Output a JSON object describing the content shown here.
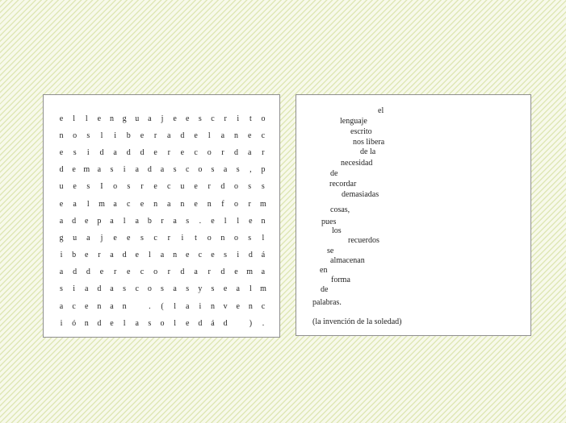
{
  "grid": {
    "rows": [
      "ellenguajeescrito",
      "nosliberadelanec",
      "esidadderecordar",
      "demasiadascosas,p",
      "uesIosrecuerdoss",
      "ealmacenanenform",
      "adepalabras.ellen",
      "guajeescritonosl",
      "iberadelanecesidá",
      "adderecordardema",
      "siadascosasysealm",
      "acenan .(lainvenc",
      "ióndelasoledád )."
    ]
  },
  "poem": {
    "words": [
      "el",
      "lenguaje",
      "escrito",
      "nos libera",
      "de   la",
      "necesidad",
      "de",
      "recordar",
      "demasiadas",
      "cosas,",
      "pues",
      "los",
      "recuerdos",
      "se",
      "almacenan",
      "en",
      "forma",
      "de",
      "palabras.",
      "(la invención de la soledad)"
    ]
  }
}
